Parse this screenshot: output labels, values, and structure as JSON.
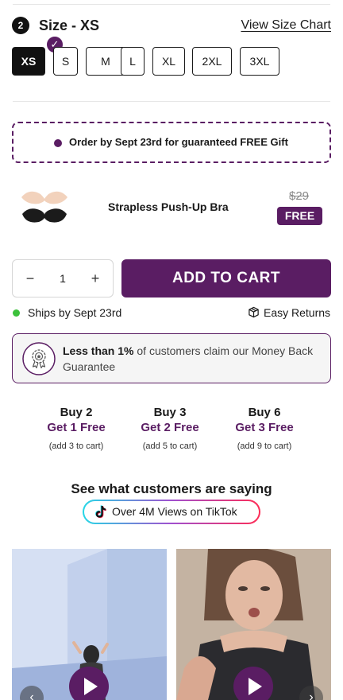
{
  "colors": {
    "brand": "#5a1d63",
    "selected_size_bg": "#111111",
    "ship_dot": "#3cc13b",
    "tiktok_gradient": [
      "#25d7e6",
      "#a04fcf",
      "#fe2c55"
    ]
  },
  "size_selector": {
    "step_number": "2",
    "title": "Size - XS",
    "size_chart_link": "View Size Chart",
    "options": [
      "XS",
      "S",
      "M",
      "L",
      "XL",
      "2XL",
      "3XL"
    ],
    "selected": "XS",
    "selected_icon": "checkmark-icon"
  },
  "gift_banner": {
    "text": "Order by Sept 23rd for guaranteed FREE Gift"
  },
  "gift_product": {
    "name": "Strapless Push-Up Bra",
    "original_price": "$29",
    "badge": "FREE"
  },
  "cart": {
    "quantity": "1",
    "minus_icon": "minus-icon",
    "plus_icon": "plus-icon",
    "add_to_cart_label": "ADD TO CART"
  },
  "shipping": {
    "ships_text": "Ships by Sept 23rd",
    "returns_text": "Easy Returns",
    "returns_icon": "box-icon"
  },
  "guarantee": {
    "bold": "Less than 1%",
    "rest": " of customers claim our Money Back Guarantee",
    "icon": "award-seal-icon"
  },
  "bundles": [
    {
      "title": "Buy 2",
      "free": "Get 1 Free",
      "note": "(add 3 to cart)"
    },
    {
      "title": "Buy 3",
      "free": "Get 2 Free",
      "note": "(add 5 to cart)"
    },
    {
      "title": "Buy 6",
      "free": "Get 3 Free",
      "note": "(add 9 to cart)"
    }
  ],
  "reviews": {
    "title": "See what customers are saying",
    "tiktok_label": "Over 4M Views on TikTok",
    "tiktok_icon": "tiktok-icon"
  },
  "videos": [
    {
      "icon": "play-icon"
    },
    {
      "icon": "play-icon"
    }
  ]
}
